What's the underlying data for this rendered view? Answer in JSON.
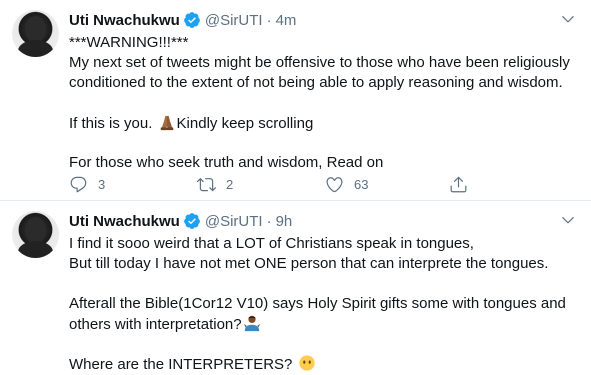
{
  "tweets": [
    {
      "name": "Uti Nwachukwu",
      "handle": "@SirUTI",
      "separator": "·",
      "time": "4m",
      "lines": [
        "***WARNING!!!***",
        "My next set of tweets might be offensive to those who have been religiously",
        "conditioned to the extent of not being able to apply reasoning and wisdom.",
        "",
        "If this is you.",
        "Kindly keep scrolling",
        "",
        "For those who seek truth and wisdom, Read on"
      ],
      "replies": "3",
      "retweets": "2",
      "likes": "63"
    },
    {
      "name": "Uti Nwachukwu",
      "handle": "@SirUTI",
      "separator": "·",
      "time": "9h",
      "lines": [
        "I find it sooo weird that a LOT of Christians speak in tongues,",
        "But till today I have not met ONE person that can interprete the tongues.",
        "",
        "Afterall the Bible(1Cor12 V10) says Holy Spirit gifts some with tongues and",
        "others with interpretation?",
        "",
        "Where are the INTERPRETERS?"
      ]
    }
  ],
  "icons": {
    "verified": "verified-badge-icon",
    "more": "chevron-down-icon",
    "reply": "reply-icon",
    "retweet": "retweet-icon",
    "like": "heart-icon",
    "share": "share-icon",
    "emoji_pray": "folded-hands-emoji",
    "emoji_shrug": "person-shrugging-emoji",
    "emoji_no_mouth": "face-without-mouth-emoji"
  },
  "colors": {
    "verified": "#1da1f2",
    "secondary_text": "#5b7083",
    "divider": "#e6ecf0"
  }
}
